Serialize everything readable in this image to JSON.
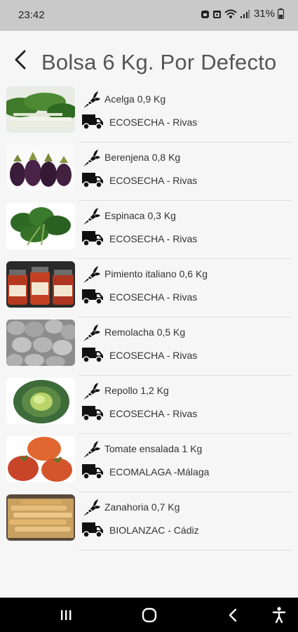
{
  "status_bar": {
    "time": "23:42",
    "battery": "31%",
    "icons": [
      "alarm-icon",
      "calendar-icon",
      "wifi-icon",
      "signal-icon",
      "battery-icon"
    ]
  },
  "header": {
    "back_icon": "back-arrow-icon",
    "title": "Bolsa 6 Kg. Por Defecto"
  },
  "items": [
    {
      "product": "Acelga 0,9 Kg",
      "supplier": "ECOSECHA - Rivas",
      "image": "chard"
    },
    {
      "product": "Berenjena 0,8 Kg",
      "supplier": "ECOSECHA - Rivas",
      "image": "eggplant"
    },
    {
      "product": "Espinaca 0,3 Kg",
      "supplier": "ECOSECHA - Rivas",
      "image": "spinach"
    },
    {
      "product": "Pimiento italiano 0,6 Kg",
      "supplier": "ECOSECHA - Rivas",
      "image": "pepper-jars"
    },
    {
      "product": "Remolacha 0,5 Kg",
      "supplier": "ECOSECHA - Rivas",
      "image": "beetroot"
    },
    {
      "product": "Repollo 1,2 Kg",
      "supplier": "ECOSECHA - Rivas",
      "image": "cabbage"
    },
    {
      "product": "Tomate ensalada 1 Kg",
      "supplier": "ECOMALAGA -Málaga",
      "image": "tomato"
    },
    {
      "product": "Zanahoria 0,7 Kg",
      "supplier": "BIOLANZAC - Cádiz",
      "image": "carrot"
    }
  ],
  "item_icons": {
    "product": "carrot-icon",
    "supplier": "truck-icon"
  },
  "nav_bar": {
    "buttons": [
      "recents-icon",
      "home-icon",
      "back-icon",
      "accessibility-icon"
    ]
  },
  "colors": {
    "status_bar_bg": "#c9c9c9",
    "page_bg": "#f6f6f6",
    "title_text": "#555555",
    "nav_bar_bg": "#000000"
  }
}
